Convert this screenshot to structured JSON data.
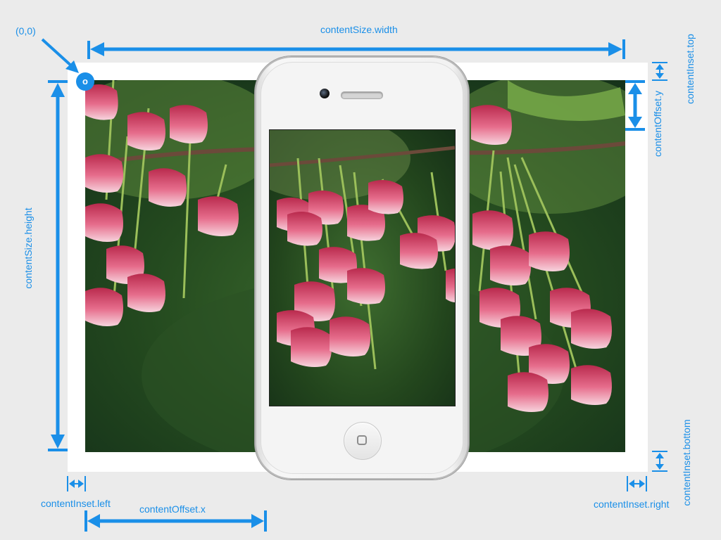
{
  "labels": {
    "origin": "(0,0)",
    "origin_marker": "o",
    "content_size_width": "contentSize.width",
    "content_size_height": "contentSize.height",
    "content_inset_top": "contentInset.top",
    "content_inset_bottom": "contentInset.bottom",
    "content_inset_left": "contentInset.left",
    "content_inset_right": "contentInset.right",
    "content_offset_x": "contentOffset.x",
    "content_offset_y": "contentOffset.y"
  },
  "colors": {
    "accent": "#1a8fe8",
    "background": "#ebebeb",
    "content_area": "#ffffff"
  },
  "icons": {
    "home_button": "rounded-square-icon",
    "camera": "camera-icon",
    "speaker": "speaker-grille-icon"
  }
}
